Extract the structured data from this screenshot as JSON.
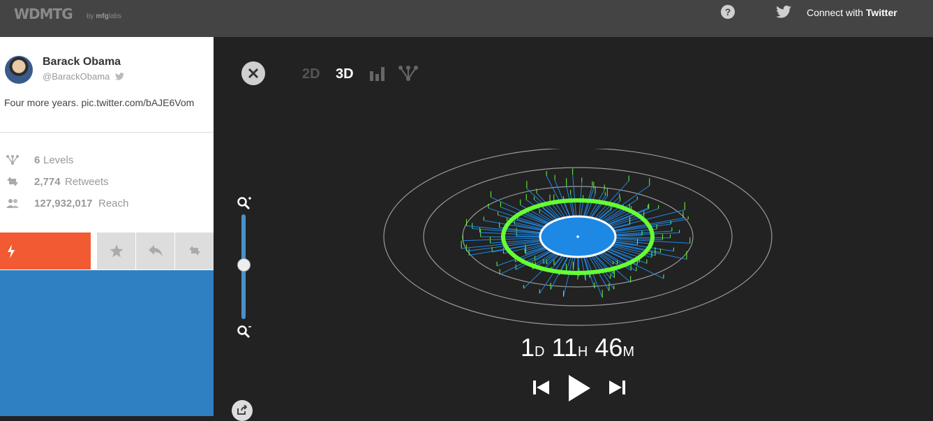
{
  "header": {
    "logo": "WDMTG",
    "byline_prefix": "by",
    "byline_brand": "mfg",
    "byline_suffix": "labs",
    "help_label": "?",
    "connect_prefix": "Connect with",
    "connect_brand": "Twitter"
  },
  "tweet": {
    "name": "Barack Obama",
    "handle": "@BarackObama",
    "text": "Four more years. pic.twitter.com/bAJE6Vom"
  },
  "stats": [
    {
      "icon": "levels-icon",
      "value": "6",
      "label": "Levels"
    },
    {
      "icon": "retweet-icon",
      "value": "2,774",
      "label": "Retweets"
    },
    {
      "icon": "reach-icon",
      "value": "127,932,017",
      "label": "Reach"
    }
  ],
  "views": {
    "two_d": "2D",
    "three_d": "3D",
    "active": "3D"
  },
  "zoom": {
    "level": 0.5
  },
  "timer": {
    "days": "1",
    "days_unit": "D",
    "hours": "11",
    "hours_unit": "H",
    "minutes": "46",
    "minutes_unit": "M"
  },
  "colors": {
    "accent_orange": "#f15a32",
    "accent_blue": "#2f80c3",
    "graph_green": "#66ff33",
    "graph_blue": "#1e88e5"
  }
}
